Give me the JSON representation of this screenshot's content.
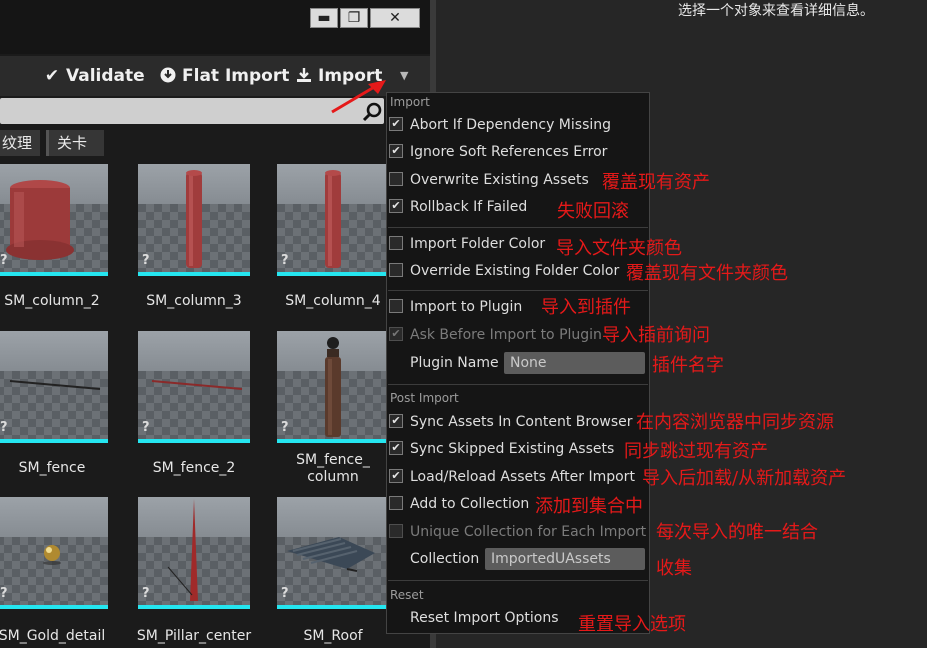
{
  "details": {
    "hint": "选择一个对象来查看详细信息。"
  },
  "window": {
    "controls": {
      "minimize": "▬",
      "maximize": "❐",
      "close": "✕"
    }
  },
  "toolbar": {
    "validate": "Validate",
    "flat_import": "Flat Import",
    "import": "Import",
    "dropdown": "▼"
  },
  "filters": [
    "纹理",
    "关卡"
  ],
  "tiles": [
    {
      "label": "SM_column_2",
      "shape": "drum"
    },
    {
      "label": "SM_column_3",
      "shape": "pillar"
    },
    {
      "label": "SM_column_4",
      "shape": "pillar"
    },
    {
      "label": "SM_fence",
      "shape": "line-dark"
    },
    {
      "label": "SM_fence_2",
      "shape": "line-red"
    },
    {
      "label": "SM_fence_ column",
      "shape": "post"
    },
    {
      "label": "SM_Gold_detail",
      "shape": "ball"
    },
    {
      "label": "SM_Pillar_center",
      "shape": "spike"
    },
    {
      "label": "SM_Roof",
      "shape": "roof"
    }
  ],
  "menu": {
    "sections": {
      "import": "Import",
      "post_import": "Post Import",
      "reset": "Reset"
    },
    "items": {
      "abort_missing": {
        "label": "Abort If Dependency Missing",
        "checked": true
      },
      "ignore_soft": {
        "label": "Ignore Soft References Error",
        "checked": true
      },
      "overwrite_assets": {
        "label": "Overwrite Existing Assets",
        "checked": false,
        "note": "覆盖现有资产"
      },
      "rollback": {
        "label": "Rollback If Failed",
        "checked": true,
        "note": "失败回滚"
      },
      "import_folder_color": {
        "label": "Import Folder Color",
        "checked": false,
        "note": "导入文件夹颜色"
      },
      "override_folder_color": {
        "label": "Override Existing Folder Color",
        "checked": false,
        "note": "覆盖现有文件夹颜色"
      },
      "import_plugin": {
        "label": "Import to Plugin",
        "checked": false,
        "note": "导入到插件"
      },
      "ask_plugin": {
        "label": "Ask Before Import to Plugin",
        "checked": true,
        "note": "导入插前询问"
      },
      "plugin_name": {
        "label": "Plugin Name",
        "value": "None",
        "note": "插件名字"
      },
      "sync_assets": {
        "label": "Sync Assets In Content Browser",
        "checked": true,
        "note": "在内容浏览器中同步资源"
      },
      "sync_skipped": {
        "label": "Sync Skipped Existing Assets",
        "checked": true,
        "note": "同步跳过现有资产"
      },
      "load_reload": {
        "label": "Load/Reload Assets After Import",
        "checked": true,
        "note": "导入后加载/从新加载资产"
      },
      "add_collection": {
        "label": "Add to Collection",
        "checked": false,
        "note": "添加到集合中"
      },
      "unique_collection": {
        "label": "Unique Collection for Each Import",
        "checked": false,
        "note": "每次导入的唯一结合"
      },
      "collection": {
        "label": "Collection",
        "value": "ImportedUAssets",
        "note": "收集"
      },
      "reset_options": {
        "label": "Reset Import Options",
        "note": "重置导入选项"
      }
    }
  },
  "colors": {
    "accent_bar": "#25e6f0",
    "annotation": "#e51919"
  }
}
